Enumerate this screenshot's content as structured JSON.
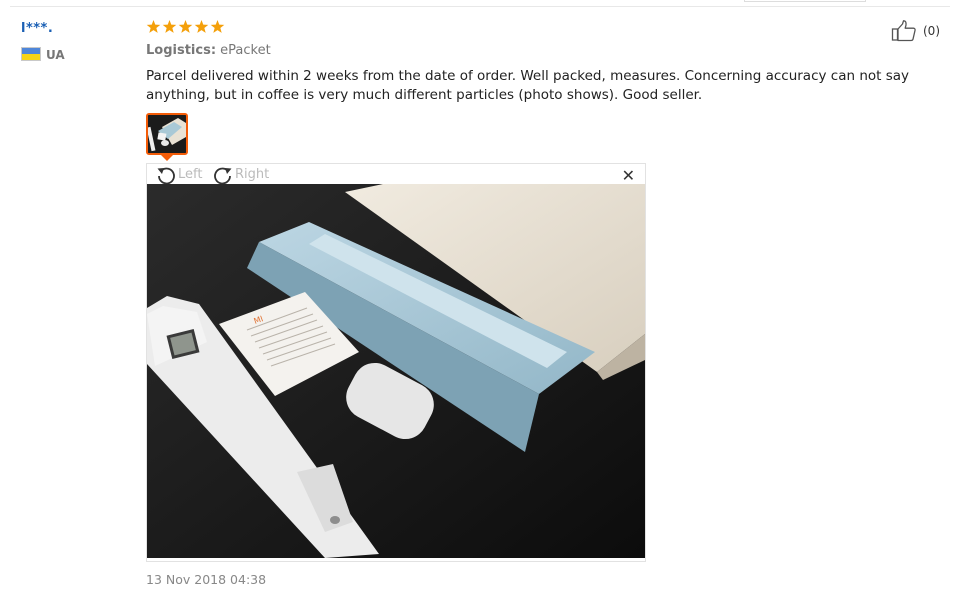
{
  "review": {
    "user": "l***.",
    "country": "UA",
    "rating": 5,
    "logistics_label": "Logistics:",
    "logistics_value": "ePacket",
    "text": "Parcel delivered within 2 weeks from the date of order. Well packed, measures. Concerning accuracy can not say anything, but in coffee is very much different particles (photo shows). Good seller.",
    "helpful_count": "(0)",
    "date": "13 Nov 2018 04:38"
  },
  "viewer": {
    "rotate_left_label": "Left",
    "rotate_right_label": "Right",
    "close_label": "✕"
  },
  "photo_print": {
    "card_brand": "MI"
  },
  "colors": {
    "star": "#f4a00b",
    "accent": "#f35c08",
    "username": "#1a5fb4",
    "flag_blue": "#4f86d9",
    "flag_yellow": "#f7d417"
  },
  "icons": {
    "helpful": "thumbs-up-icon",
    "rotate_left": "rotate-left-icon",
    "rotate_right": "rotate-right-icon",
    "close": "close-icon",
    "star": "star-icon"
  }
}
